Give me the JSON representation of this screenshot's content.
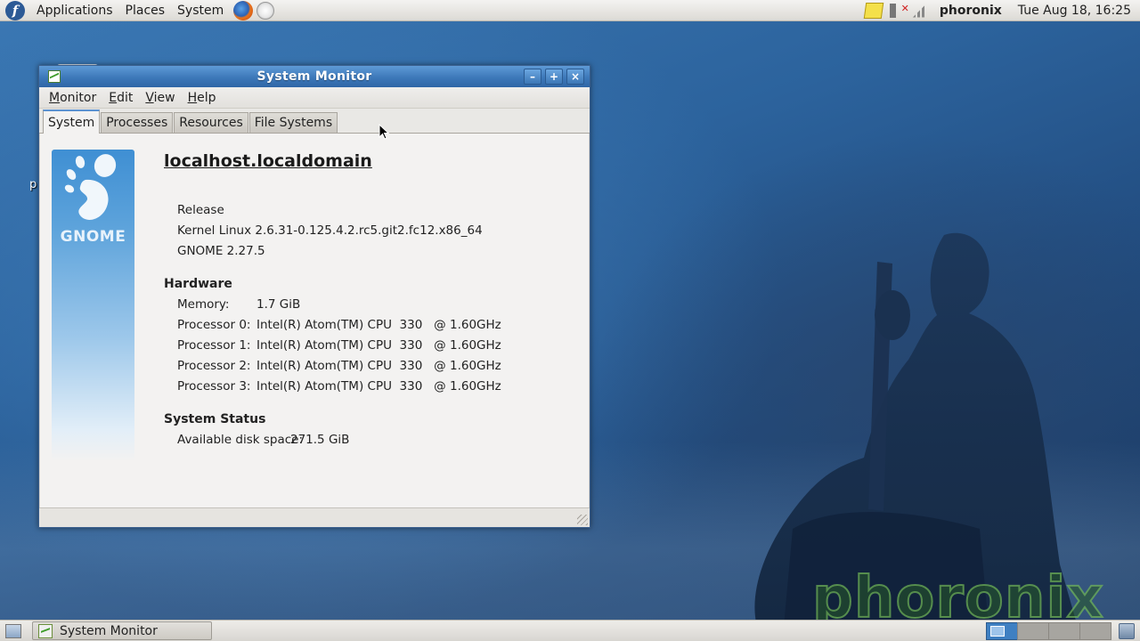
{
  "top_panel": {
    "menus": [
      "Applications",
      "Places",
      "System"
    ],
    "username": "phoronix",
    "clock": "Tue Aug 18, 16:25"
  },
  "desktop": {
    "icon_label": "p",
    "watermark": "phoronix"
  },
  "window": {
    "title": "System Monitor",
    "buttons": {
      "minimize": "–",
      "maximize": "+",
      "close": "×"
    },
    "menubar": [
      {
        "mnemonic": "M",
        "rest": "onitor"
      },
      {
        "mnemonic": "E",
        "rest": "dit"
      },
      {
        "mnemonic": "V",
        "rest": "iew"
      },
      {
        "mnemonic": "H",
        "rest": "elp"
      }
    ],
    "tabs": [
      "System",
      "Processes",
      "Resources",
      "File Systems"
    ],
    "active_tab": "System"
  },
  "system_info": {
    "logo_text": "GNOME",
    "hostname": "localhost.localdomain",
    "release": "Release",
    "kernel": "Kernel Linux 2.6.31-0.125.4.2.rc5.git2.fc12.x86_64",
    "gnome_version": "GNOME 2.27.5",
    "hardware_heading": "Hardware",
    "memory_label": "Memory:",
    "memory_value": "1.7 GiB",
    "processors": [
      {
        "label": "Processor 0:",
        "value": "Intel(R) Atom(TM) CPU  330   @ 1.60GHz"
      },
      {
        "label": "Processor 1:",
        "value": "Intel(R) Atom(TM) CPU  330   @ 1.60GHz"
      },
      {
        "label": "Processor 2:",
        "value": "Intel(R) Atom(TM) CPU  330   @ 1.60GHz"
      },
      {
        "label": "Processor 3:",
        "value": "Intel(R) Atom(TM) CPU  330   @ 1.60GHz"
      }
    ],
    "status_heading": "System Status",
    "disk_label": "Available disk space:",
    "disk_value": "271.5 GiB"
  },
  "bottom_panel": {
    "task_label": "System Monitor",
    "workspace_count": 4,
    "active_workspace": 1
  },
  "colors": {
    "titlebar": "#3d78b9",
    "tab_accent": "#5b92d1",
    "gnome_panel": "#3f8fd3"
  }
}
